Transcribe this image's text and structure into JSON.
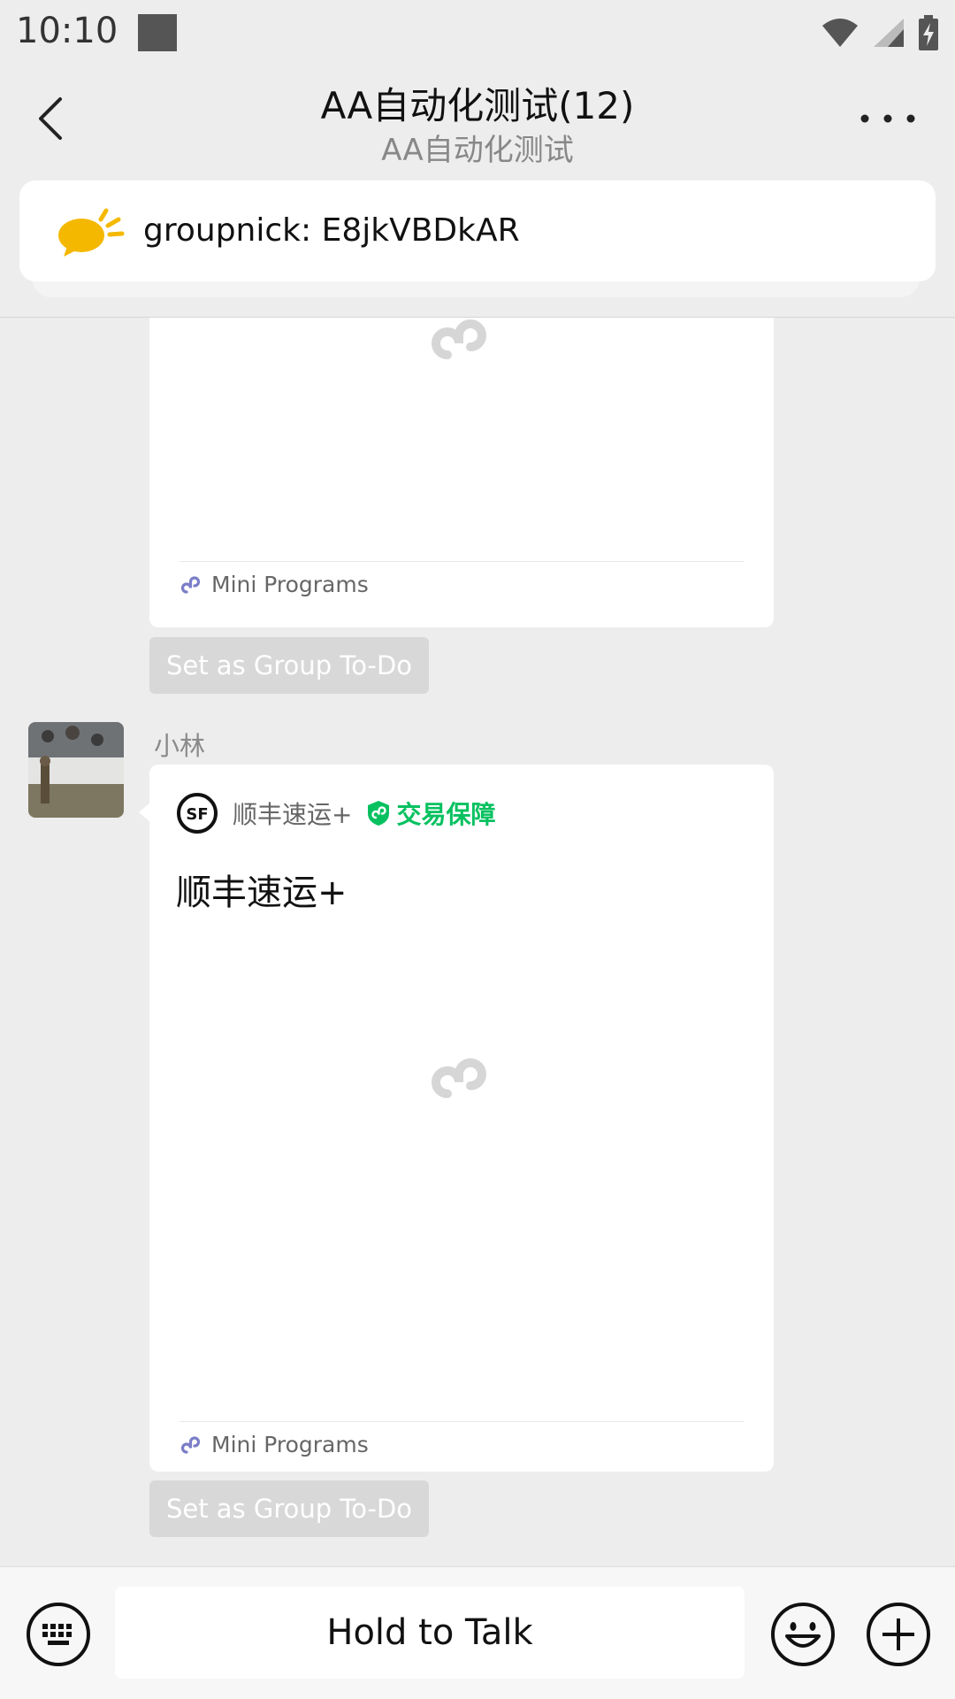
{
  "status_bar": {
    "time": "10:10",
    "icons": [
      "wifi-icon",
      "signal-icon",
      "battery-charging-icon"
    ]
  },
  "header": {
    "title": "AA自动化测试(12)",
    "subtitle": "AA自动化测试",
    "back_icon": "chevron-left-icon",
    "more_icon": "more-dots-icon"
  },
  "pinned": {
    "icon": "announcement-bubble-icon",
    "text": "groupnick: E8jkVBDkAR",
    "icon_color": "#f5b800"
  },
  "messages": [
    {
      "type": "mini-program",
      "footer_label": "Mini Programs",
      "todo_label": "Set as Group To-Do"
    },
    {
      "type": "mini-program",
      "sender": "小林",
      "brand_name": "顺丰速运+",
      "badge": "交易保障",
      "title": "顺丰速运+",
      "footer_label": "Mini Programs",
      "todo_label": "Set as Group To-Do"
    }
  ],
  "input_bar": {
    "talk_label": "Hold to Talk",
    "icons": [
      "keyboard-icon",
      "emoji-icon",
      "plus-icon"
    ]
  },
  "colors": {
    "background": "#ededed",
    "accent_green": "#07c160",
    "mini_program_icon": "#7b7ec8",
    "todo_button": "#d8d8d8"
  }
}
